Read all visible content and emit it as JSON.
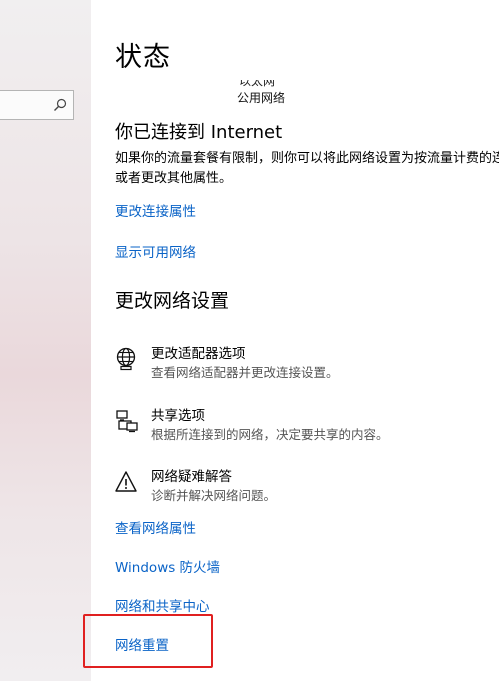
{
  "search": {
    "placeholder": ""
  },
  "status": {
    "title": "状态",
    "icon_caption": "以太网",
    "network_profile": "公用网络",
    "connected_heading": "你已连接到 Internet",
    "metered_description": "如果你的流量套餐有限制，则你可以将此网络设置为按流量计费的连接，或者更改其他属性。",
    "link_change_properties": "更改连接属性",
    "link_show_networks": "显示可用网络"
  },
  "change_settings": {
    "heading": "更改网络设置",
    "options": [
      {
        "title": "更改适配器选项",
        "description": "查看网络适配器并更改连接设置。",
        "icon": "adapter-globe-icon"
      },
      {
        "title": "共享选项",
        "description": "根据所连接到的网络，决定要共享的内容。",
        "icon": "sharing-icon"
      },
      {
        "title": "网络疑难解答",
        "description": "诊断并解决网络问题。",
        "icon": "warning-icon"
      }
    ]
  },
  "links": {
    "view_properties": "查看网络属性",
    "firewall": "Windows 防火墙",
    "sharing_center": "网络和共享中心",
    "network_reset": "网络重置"
  },
  "colors": {
    "link": "#0a63c7",
    "highlight": "#e02020"
  }
}
